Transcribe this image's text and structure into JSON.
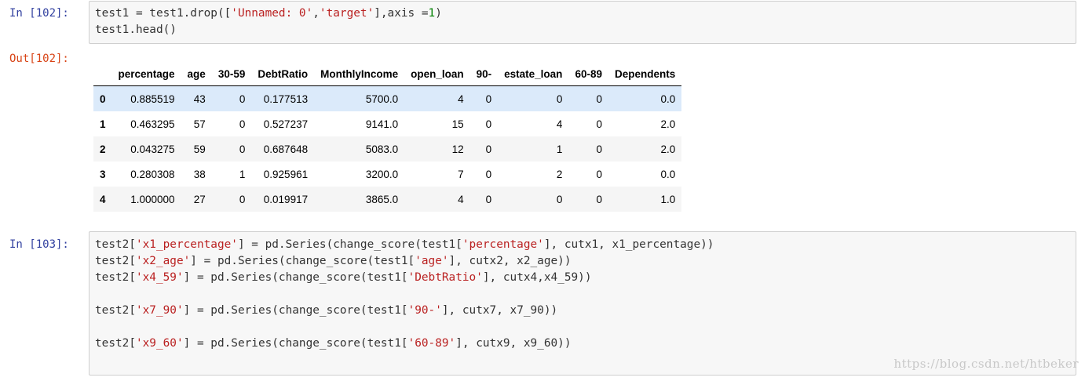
{
  "cell1": {
    "prompt": "In [102]:",
    "line1": {
      "a": "test1 = test1.drop([",
      "s1": "'Unnamed: 0'",
      "b": ",",
      "s2": "'target'",
      "c": "],axis =",
      "n": "1",
      "d": ")"
    },
    "line2": "test1.head()"
  },
  "output": {
    "prompt": "Out[102]:",
    "columns": [
      "",
      "percentage",
      "age",
      "30-59",
      "DebtRatio",
      "MonthlyIncome",
      "open_loan",
      "90-",
      "estate_loan",
      "60-89",
      "Dependents"
    ],
    "rows": [
      [
        "0",
        "0.885519",
        "43",
        "0",
        "0.177513",
        "5700.0",
        "4",
        "0",
        "0",
        "0",
        "0.0"
      ],
      [
        "1",
        "0.463295",
        "57",
        "0",
        "0.527237",
        "9141.0",
        "15",
        "0",
        "4",
        "0",
        "2.0"
      ],
      [
        "2",
        "0.043275",
        "59",
        "0",
        "0.687648",
        "5083.0",
        "12",
        "0",
        "1",
        "0",
        "2.0"
      ],
      [
        "3",
        "0.280308",
        "38",
        "1",
        "0.925961",
        "3200.0",
        "7",
        "0",
        "2",
        "0",
        "0.0"
      ],
      [
        "4",
        "1.000000",
        "27",
        "0",
        "0.019917",
        "3865.0",
        "4",
        "0",
        "0",
        "0",
        "1.0"
      ]
    ]
  },
  "cell2": {
    "prompt": "In [103]:",
    "lines": [
      {
        "a": "test2[",
        "s1": "'x1_percentage'",
        "b": "] = pd.Series(change_score(test1[",
        "s2": "'percentage'",
        "c": "], cutx1, x1_percentage))"
      },
      {
        "a": "test2[",
        "s1": "'x2_age'",
        "b": "] = pd.Series(change_score(test1[",
        "s2": "'age'",
        "c": "], cutx2, x2_age))"
      },
      {
        "a": "test2[",
        "s1": "'x4_59'",
        "b": "] = pd.Series(change_score(test1[",
        "s2": "'DebtRatio'",
        "c": "], cutx4,x4_59))"
      },
      {
        "a": "",
        "s1": "",
        "b": "",
        "s2": "",
        "c": ""
      },
      {
        "a": "test2[",
        "s1": "'x7_90'",
        "b": "] = pd.Series(change_score(test1[",
        "s2": "'90-'",
        "c": "], cutx7, x7_90))"
      },
      {
        "a": "",
        "s1": "",
        "b": "",
        "s2": "",
        "c": ""
      },
      {
        "a": "test2[",
        "s1": "'x9_60'",
        "b": "] = pd.Series(change_score(test1[",
        "s2": "'60-89'",
        "c": "], cutx9, x9_60))"
      }
    ]
  },
  "watermark": "https://blog.csdn.net/htbeker",
  "colors": {
    "prompt_in": "#303f9f",
    "prompt_out": "#d84315",
    "string": "#ba2121",
    "number": "#008000",
    "selected_row": "#dbeafa"
  }
}
